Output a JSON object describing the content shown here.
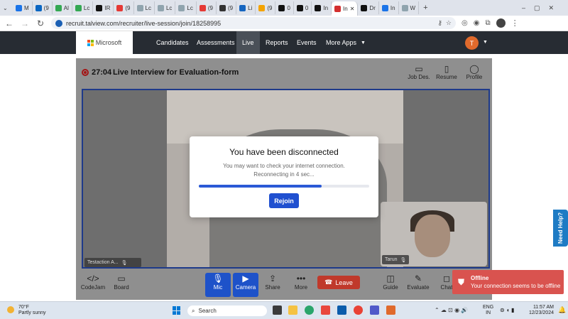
{
  "browser": {
    "tabs": [
      {
        "label": "M",
        "color": "#1a73e8"
      },
      {
        "label": "(9",
        "color": "#0a66c2"
      },
      {
        "label": "Al",
        "color": "#34a853"
      },
      {
        "label": "Lc",
        "color": "#34a853"
      },
      {
        "label": "IR",
        "color": "#111111"
      },
      {
        "label": "(9",
        "color": "#e53935"
      },
      {
        "label": "Lc",
        "color": "#90a4ae"
      },
      {
        "label": "Lc",
        "color": "#90a4ae"
      },
      {
        "label": "Lc",
        "color": "#90a4ae"
      },
      {
        "label": "(9",
        "color": "#e53935"
      },
      {
        "label": "(9",
        "color": "#333333"
      },
      {
        "label": "Li",
        "color": "#1565c0"
      },
      {
        "label": "(9",
        "color": "#f4a300"
      },
      {
        "label": "0",
        "color": "#111111"
      },
      {
        "label": "0",
        "color": "#111111"
      },
      {
        "label": "In",
        "color": "#111111"
      },
      {
        "label": "In",
        "color": "#d32f2f",
        "active": true
      },
      {
        "label": "Dr",
        "color": "#111111"
      },
      {
        "label": "In",
        "color": "#1a73e8"
      },
      {
        "label": "W",
        "color": "#90a4ae"
      }
    ],
    "new_tab": "+",
    "url": "recruit.talview.com/recruiter/live-session/join/18258995",
    "profile_initial": "T"
  },
  "app": {
    "logo_text": "Microsoft",
    "nav": [
      "Candidates",
      "Assessments",
      "Live",
      "Reports",
      "Events",
      "More Apps"
    ],
    "active_nav": "Live",
    "avatar_initial": "T"
  },
  "session": {
    "timer": "27:04",
    "title": "Live Interview for Evaluation-form",
    "header_buttons": [
      {
        "label": "Job Des.",
        "icon": "briefcase-icon"
      },
      {
        "label": "Resume",
        "icon": "document-icon"
      },
      {
        "label": "Profile",
        "icon": "person-icon"
      }
    ],
    "main_participant": "Testaction A...",
    "pip_participant": "Tarun"
  },
  "modal": {
    "title": "You have been disconnected",
    "line1": "You may want to check your internet connection.",
    "line2": "Reconnecting in 4 sec...",
    "progress": 0.72,
    "button": "Rejoin"
  },
  "controls": {
    "codejam": "CodeJam",
    "board": "Board",
    "mic": "Mic",
    "camera": "Camera",
    "share": "Share",
    "more": "More",
    "leave": "Leave",
    "guide": "Guide",
    "evaluate": "Evaluate",
    "chat": "Chat"
  },
  "toast": {
    "title": "Offline",
    "message": "Your connection seems to be offline"
  },
  "help": "Need Help?",
  "taskbar": {
    "temp": "70°F",
    "weather": "Partly sunny",
    "search": "Search",
    "lang1": "ENG",
    "lang2": "IN",
    "time": "11:57 AM",
    "date": "12/23/2024"
  }
}
